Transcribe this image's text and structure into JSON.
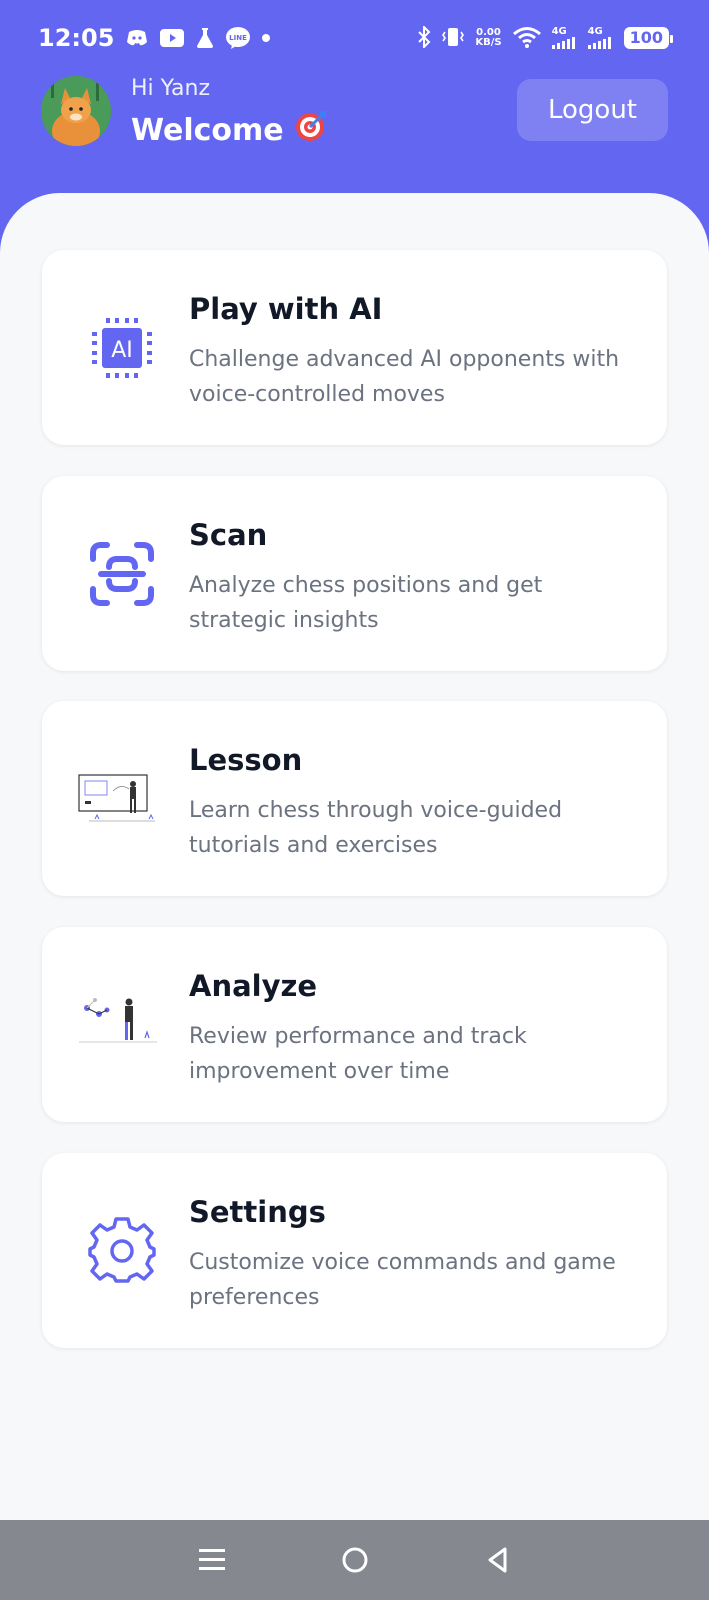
{
  "status": {
    "time": "12:05",
    "net_speed_top": "0.00",
    "net_speed_bottom": "KB/S",
    "signal1": "4G",
    "signal2": "4G",
    "battery": "100"
  },
  "header": {
    "greeting": "Hi Yanz",
    "welcome": "Welcome",
    "welcome_emoji": "🎯",
    "logout_label": "Logout"
  },
  "cards": [
    {
      "title": "Play with AI",
      "desc": "Challenge advanced AI opponents with voice-controlled moves",
      "icon": "ai-chip-icon"
    },
    {
      "title": "Scan",
      "desc": "Analyze chess positions and get strategic insights",
      "icon": "scan-icon"
    },
    {
      "title": "Lesson",
      "desc": "Learn chess through voice-guided tutorials and exercises",
      "icon": "lesson-illustration"
    },
    {
      "title": "Analyze",
      "desc": "Review performance and track improvement over time",
      "icon": "analyze-illustration"
    },
    {
      "title": "Settings",
      "desc": "Customize voice commands and game preferences",
      "icon": "gear-icon"
    }
  ],
  "colors": {
    "primary": "#6366f1",
    "background": "#f7f8fa",
    "title": "#111827",
    "description": "#6b7280"
  }
}
